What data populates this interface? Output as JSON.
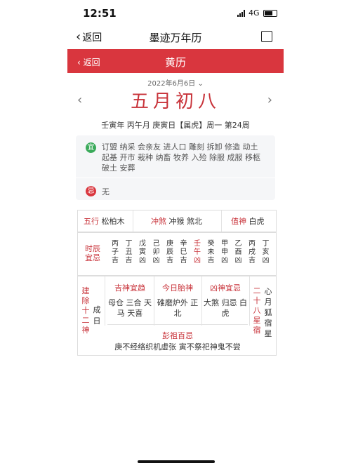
{
  "status": {
    "time": "12:51",
    "network": "4G"
  },
  "nav": {
    "back_label": "返回",
    "title": "墨迹万年历"
  },
  "redbar": {
    "back_label": "返回",
    "title": "黄历"
  },
  "date": {
    "solar": "2022年6月6日",
    "lunar": "五月初八",
    "ganzhi_line": "壬寅年 丙午月 庚寅日【属虎】周一 第24周"
  },
  "yi": {
    "badge": "宜",
    "text": "订盟 纳采 会亲友 进人口 雕刻 拆卸 修造 动土 起基 开市 栽种 纳畜 牧养 入殓 除服 成服 移柩 破土 安葬"
  },
  "ji": {
    "badge": "忌",
    "text": "无"
  },
  "wuxing_row": {
    "wuxing_label": "五行",
    "wuxing_value": "松柏木",
    "chongsha_label": "冲煞",
    "chongsha_value": "冲猴 煞北",
    "zhishen_label": "值神",
    "zhishen_value": "白虎"
  },
  "shichen": {
    "label": "时辰宜忌",
    "hours": [
      {
        "stem": "丙",
        "branch": "子",
        "luck": "吉",
        "current": false
      },
      {
        "stem": "丁",
        "branch": "丑",
        "luck": "吉",
        "current": false
      },
      {
        "stem": "戊",
        "branch": "寅",
        "luck": "凶",
        "current": false
      },
      {
        "stem": "己",
        "branch": "卯",
        "luck": "凶",
        "current": false
      },
      {
        "stem": "庚",
        "branch": "辰",
        "luck": "吉",
        "current": false
      },
      {
        "stem": "辛",
        "branch": "巳",
        "luck": "吉",
        "current": false
      },
      {
        "stem": "壬",
        "branch": "午",
        "luck": "凶",
        "current": true
      },
      {
        "stem": "癸",
        "branch": "未",
        "luck": "吉",
        "current": false
      },
      {
        "stem": "甲",
        "branch": "申",
        "luck": "凶",
        "current": false
      },
      {
        "stem": "乙",
        "branch": "酉",
        "luck": "凶",
        "current": false
      },
      {
        "stem": "丙",
        "branch": "戌",
        "luck": "吉",
        "current": false
      },
      {
        "stem": "丁",
        "branch": "亥",
        "luck": "凶",
        "current": false
      }
    ]
  },
  "bottom": {
    "jianchu_label": "建除十二神",
    "jianchu_value": "成日",
    "jishen": {
      "title": "吉神宜趋",
      "body": "母仓 三合 天马 天喜"
    },
    "taishen": {
      "title": "今日胎神",
      "body": "碓磨炉外 正北"
    },
    "xiongshen": {
      "title": "凶神宜忌",
      "body": "大煞 归忌 白虎"
    },
    "xiu_label": "二十八星宿",
    "xiu_value": "心月狐宿星",
    "pengzu_title": "彭祖百忌",
    "pengzu_body": "庚不经络织机虚张 寅不祭祀神鬼不尝"
  }
}
